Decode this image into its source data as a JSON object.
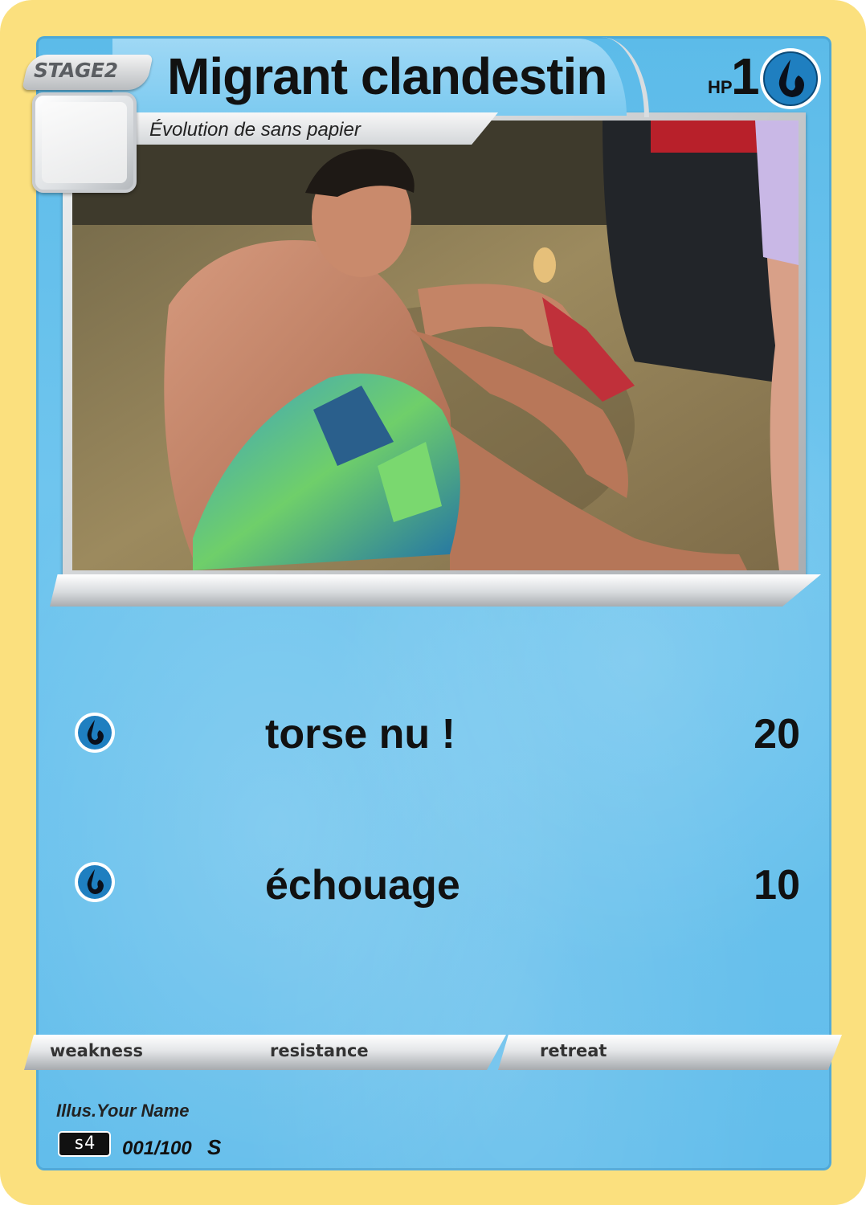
{
  "card": {
    "stage": "STAGE2",
    "name": "Migrant clandestin",
    "hp_label": "HP",
    "hp_value": "1",
    "evolution_text": "Évolution de sans papier",
    "type_icon": "water-energy-icon",
    "type_color": "#1f7fc0"
  },
  "attacks": [
    {
      "cost_icon": "water-energy-icon",
      "name": "torse nu !",
      "damage": "20"
    },
    {
      "cost_icon": "water-energy-icon",
      "name": "échouage",
      "damage": "10"
    }
  ],
  "stats": {
    "weakness_label": "weakness",
    "resistance_label": "resistance",
    "retreat_label": "retreat"
  },
  "footer": {
    "illustrator": "Illus.Your Name",
    "set_code": "s4",
    "card_number": "001/100",
    "rarity_symbol": "S"
  },
  "colors": {
    "card_border": "#fbe07e",
    "card_body": "#62bdeb"
  }
}
